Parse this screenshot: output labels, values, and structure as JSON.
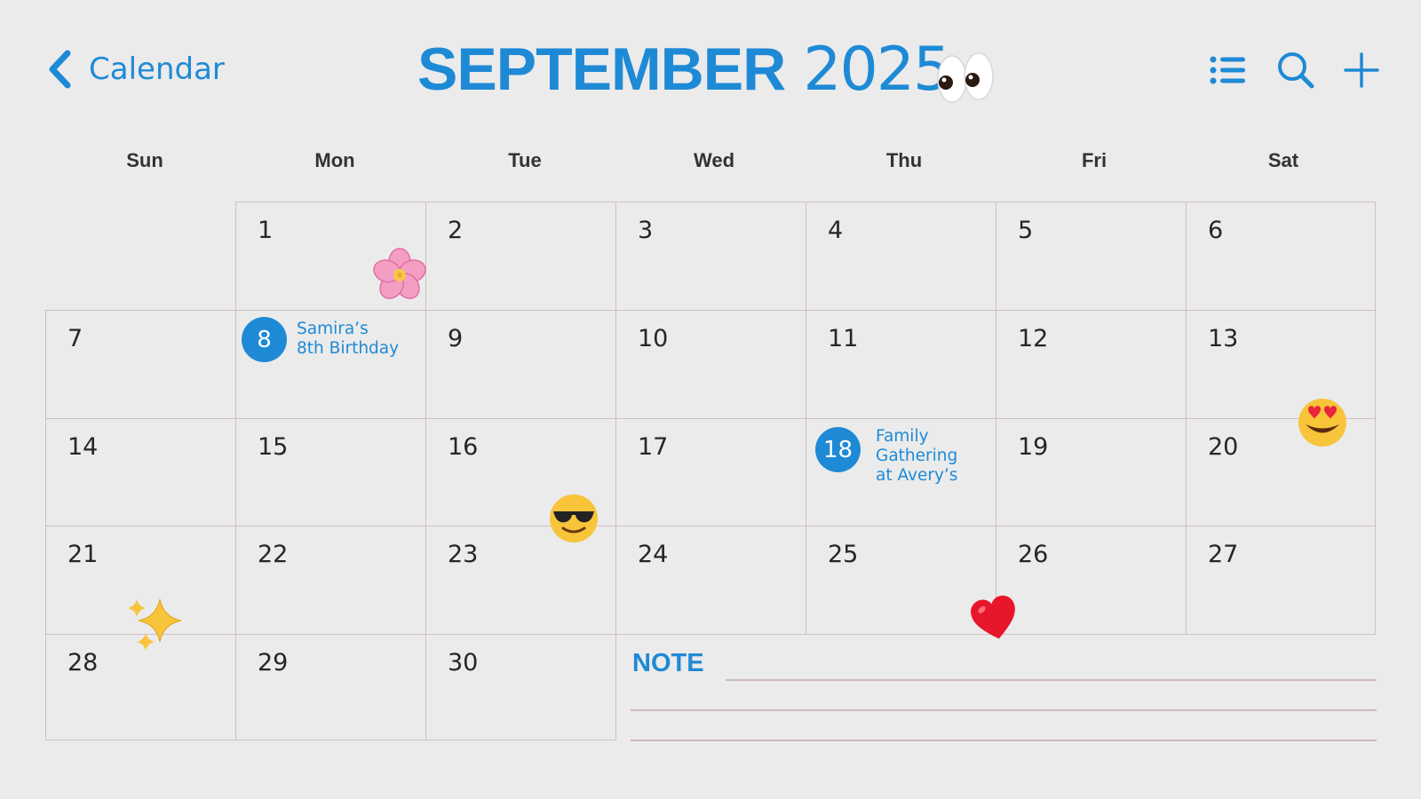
{
  "header": {
    "back_label": "Calendar",
    "month": "SEPTEMBER",
    "year": "2025"
  },
  "weekdays": [
    "Sun",
    "Mon",
    "Tue",
    "Wed",
    "Thu",
    "Fri",
    "Sat"
  ],
  "weeks": [
    [
      "",
      "1",
      "2",
      "3",
      "4",
      "5",
      "6"
    ],
    [
      "7",
      "8",
      "9",
      "10",
      "11",
      "12",
      "13"
    ],
    [
      "14",
      "15",
      "16",
      "17",
      "18",
      "19",
      "20"
    ],
    [
      "21",
      "22",
      "23",
      "24",
      "25",
      "26",
      "27"
    ],
    [
      "28",
      "29",
      "30"
    ]
  ],
  "events": {
    "sep8": {
      "day": "8",
      "title": "Samira’s\n8th Birthday"
    },
    "sep18": {
      "day": "18",
      "title": "Family\nGathering\nat Avery’s"
    }
  },
  "notes": {
    "label": "NOTE"
  },
  "icons": {
    "back": "chevron-left-icon",
    "list": "list-icon",
    "search": "search-icon",
    "add": "plus-icon"
  },
  "colors": {
    "accent": "#1e8ad6",
    "background": "#ebebeb",
    "grid_line": "#cfbfc3",
    "text": "#262626"
  }
}
